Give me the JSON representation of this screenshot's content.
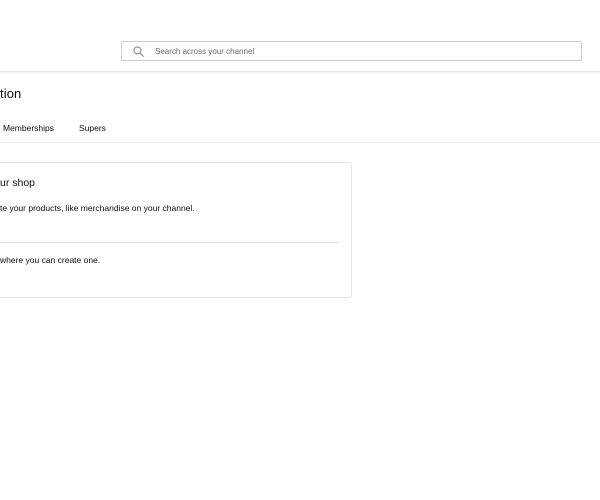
{
  "header": {
    "search": {
      "placeholder": "Search across your channel",
      "value": ""
    }
  },
  "main": {
    "title": "tion",
    "tabs": [
      {
        "label": "Memberships"
      },
      {
        "label": "Supers"
      }
    ],
    "card": {
      "title": "ur shop",
      "description": "te your products, like merchandise on your channel.",
      "note": "where you can create one."
    }
  },
  "icons": {
    "search": "search-icon"
  },
  "colors": {
    "border": "#e3e3e3",
    "text": "#0d0d0d",
    "placeholder": "#6a6a6a"
  }
}
